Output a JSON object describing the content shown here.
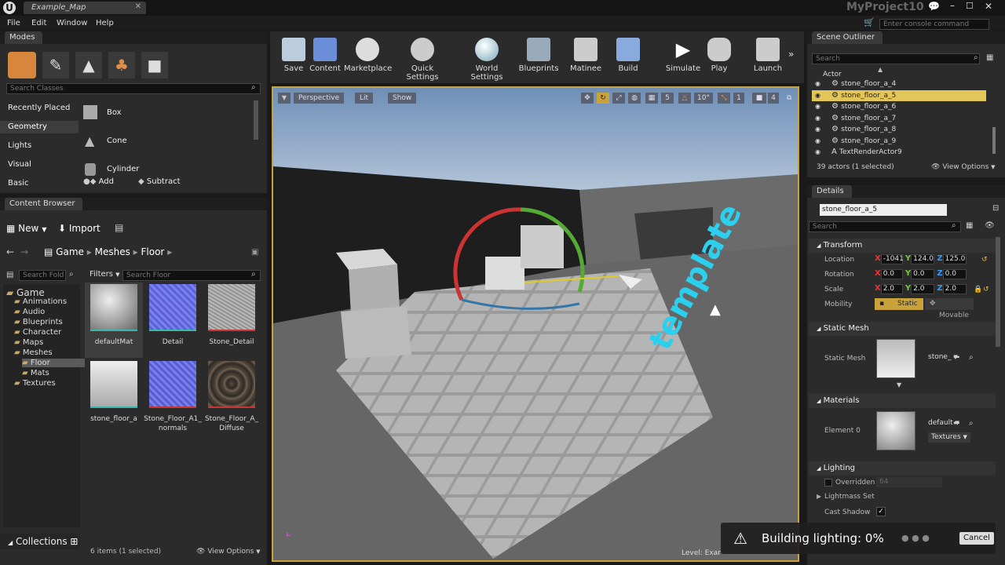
{
  "window": {
    "tab_title": "Example_Map",
    "project": "MyProject10",
    "console_placeholder": "Enter console command"
  },
  "menu": [
    "File",
    "Edit",
    "Window",
    "Help"
  ],
  "modes": {
    "tab": "Modes",
    "search_placeholder": "Search Classes",
    "categories": [
      "Recently Placed",
      "Geometry",
      "Lights",
      "Visual",
      "Basic"
    ],
    "items": [
      "Box",
      "Cone",
      "Cylinder"
    ],
    "add_label": "Add",
    "subtract_label": "Subtract"
  },
  "toolbar": [
    "Save",
    "Content",
    "Marketplace",
    "Quick Settings",
    "World Settings",
    "Blueprints",
    "Matinee",
    "Build",
    "Simulate",
    "Play",
    "Launch"
  ],
  "viewport": {
    "perspective": "Perspective",
    "lit": "Lit",
    "show": "Show",
    "snap_angle": "10°",
    "snap_grid": "5",
    "cam_speed": "4",
    "level_label": "Level: Exar",
    "overlay_text": "template"
  },
  "content_browser": {
    "tab": "Content Browser",
    "new_label": "New",
    "import_label": "Import",
    "path": [
      "Game",
      "Meshes",
      "Floor"
    ],
    "search_folders_placeholder": "Search Fold",
    "filters_label": "Filters",
    "search_placeholder": "Search Floor",
    "tree": [
      {
        "label": "Game",
        "level": 0
      },
      {
        "label": "Animations",
        "level": 1
      },
      {
        "label": "Audio",
        "level": 1
      },
      {
        "label": "Blueprints",
        "level": 1
      },
      {
        "label": "Character",
        "level": 1
      },
      {
        "label": "Maps",
        "level": 1
      },
      {
        "label": "Meshes",
        "level": 1
      },
      {
        "label": "Floor",
        "level": 2
      },
      {
        "label": "Mats",
        "level": 2
      },
      {
        "label": "Textures",
        "level": 1
      }
    ],
    "assets": [
      "defaultMat",
      "Detail",
      "Stone_Detail",
      "stone_floor_a",
      "Stone_Floor_A1_normals",
      "Stone_Floor_A_Diffuse"
    ],
    "count_label": "6 items (1 selected)",
    "view_options": "View Options",
    "collections_label": "Collections"
  },
  "outliner": {
    "tab": "Scene Outliner",
    "search_placeholder": "Search",
    "column": "Actor",
    "rows": [
      "stone_floor_a_4",
      "stone_floor_a_5",
      "stone_floor_a_6",
      "stone_floor_a_7",
      "stone_floor_a_8",
      "stone_floor_a_9",
      "TextRenderActor9"
    ],
    "status": "39 actors (1 selected)",
    "view_options": "View Options"
  },
  "details": {
    "tab": "Details",
    "name": "stone_floor_a_5",
    "search_placeholder": "Search",
    "transform_label": "Transform",
    "location_label": "Location",
    "location": [
      "-1041",
      "124.0",
      "125.0"
    ],
    "rotation_label": "Rotation",
    "rotation": [
      "0.0",
      "0.0",
      "0.0"
    ],
    "scale_label": "Scale",
    "scale": [
      "2.0",
      "2.0",
      "2.0"
    ],
    "mobility_label": "Mobility",
    "static_label": "Static",
    "movable_label": "Movable",
    "static_mesh_section": "Static Mesh",
    "static_mesh_label": "Static Mesh",
    "static_mesh_value": "stone_",
    "materials_section": "Materials",
    "element_label": "Element 0",
    "material_value": "default",
    "textures_label": "Textures",
    "lighting_section": "Lighting",
    "overridden_label": "Overridden",
    "overridden_value": "64",
    "lightmass_label": "Lightmass Set",
    "cast_shadow_label": "Cast Shadow"
  },
  "notification": {
    "text": "Building lighting:",
    "percent": "0%",
    "cancel": "Cancel"
  }
}
